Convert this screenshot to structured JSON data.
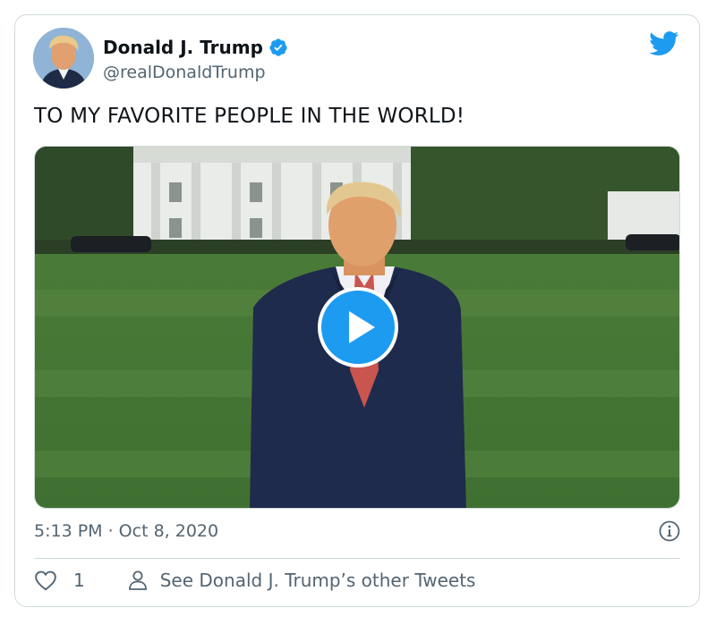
{
  "tweet": {
    "author": {
      "display_name": "Donald J. Trump",
      "handle": "@realDonaldTrump",
      "verified": true
    },
    "text": "TO MY FAVORITE PEOPLE IN THE WORLD!",
    "media": {
      "type": "video"
    },
    "timestamp": "5:13 PM · Oct 8, 2020",
    "likes": "1",
    "more_tweets_label": "See Donald J. Trump’s other Tweets"
  },
  "icons": [
    "twitter-bird-icon",
    "verified-badge-icon",
    "play-icon",
    "info-icon",
    "heart-icon",
    "person-icon"
  ],
  "colors": {
    "accent": "#1d9bf0",
    "text": "#0f1419",
    "secondary": "#536471",
    "border": "#cfd9de"
  }
}
